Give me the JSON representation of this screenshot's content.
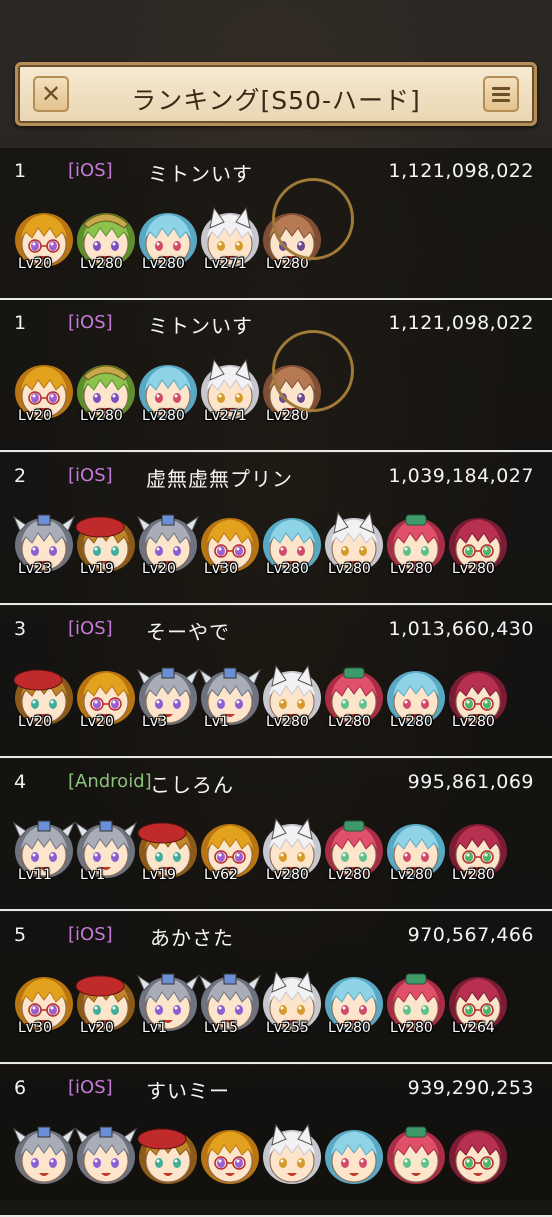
{
  "header": {
    "title": "ランキング[S50-ハード]",
    "close_icon": "close-x-icon",
    "menu_icon": "hamburger-menu-icon"
  },
  "colors": {
    "ios": "#c77ad9",
    "android": "#8cc27e",
    "gold": "#b58f57"
  },
  "entries": [
    {
      "rank": "1",
      "platform": "[iOS]",
      "name": "ミトンいす",
      "score": "1,121,098,022",
      "team": [
        {
          "level": "Lv20",
          "kind": "gold"
        },
        {
          "level": "Lv280",
          "kind": "green"
        },
        {
          "level": "Lv280",
          "kind": "blue"
        },
        {
          "level": "Lv271",
          "kind": "white"
        },
        {
          "level": "Lv280",
          "kind": "brown"
        }
      ]
    },
    {
      "rank": "1",
      "platform": "[iOS]",
      "name": "ミトンいす",
      "score": "1,121,098,022",
      "team": [
        {
          "level": "Lv20",
          "kind": "gold"
        },
        {
          "level": "Lv280",
          "kind": "green"
        },
        {
          "level": "Lv280",
          "kind": "blue"
        },
        {
          "level": "Lv271",
          "kind": "white"
        },
        {
          "level": "Lv280",
          "kind": "brown"
        }
      ]
    },
    {
      "rank": "2",
      "platform": "[iOS]",
      "name": "虚無虚無プリン",
      "score": "1,039,184,027",
      "team": [
        {
          "level": "Lv23",
          "kind": "silver"
        },
        {
          "level": "Lv19",
          "kind": "patch"
        },
        {
          "level": "Lv20",
          "kind": "silver"
        },
        {
          "level": "Lv30",
          "kind": "gold"
        },
        {
          "level": "Lv280",
          "kind": "blue"
        },
        {
          "level": "Lv280",
          "kind": "white"
        },
        {
          "level": "Lv280",
          "kind": "pink"
        },
        {
          "level": "Lv280",
          "kind": "crimson"
        }
      ]
    },
    {
      "rank": "3",
      "platform": "[iOS]",
      "name": "そーやで",
      "score": "1,013,660,430",
      "team": [
        {
          "level": "Lv20",
          "kind": "patch"
        },
        {
          "level": "Lv20",
          "kind": "gold"
        },
        {
          "level": "Lv3",
          "kind": "silver"
        },
        {
          "level": "Lv1",
          "kind": "silver"
        },
        {
          "level": "Lv280",
          "kind": "white"
        },
        {
          "level": "Lv280",
          "kind": "pink"
        },
        {
          "level": "Lv280",
          "kind": "blue"
        },
        {
          "level": "Lv280",
          "kind": "crimson"
        }
      ]
    },
    {
      "rank": "4",
      "platform": "[Android]",
      "name": "こしろん",
      "score": "995,861,069",
      "team": [
        {
          "level": "Lv11",
          "kind": "silver"
        },
        {
          "level": "Lv1",
          "kind": "silver"
        },
        {
          "level": "Lv19",
          "kind": "patch"
        },
        {
          "level": "Lv62",
          "kind": "gold"
        },
        {
          "level": "Lv280",
          "kind": "white"
        },
        {
          "level": "Lv280",
          "kind": "pink"
        },
        {
          "level": "Lv280",
          "kind": "blue"
        },
        {
          "level": "Lv280",
          "kind": "crimson"
        }
      ]
    },
    {
      "rank": "5",
      "platform": "[iOS]",
      "name": "あかさた",
      "score": "970,567,466",
      "team": [
        {
          "level": "Lv30",
          "kind": "gold"
        },
        {
          "level": "Lv20",
          "kind": "patch"
        },
        {
          "level": "Lv1",
          "kind": "silver"
        },
        {
          "level": "Lv15",
          "kind": "silver"
        },
        {
          "level": "Lv255",
          "kind": "white"
        },
        {
          "level": "Lv280",
          "kind": "blue"
        },
        {
          "level": "Lv280",
          "kind": "pink"
        },
        {
          "level": "Lv264",
          "kind": "crimson"
        }
      ]
    },
    {
      "rank": "6",
      "platform": "[iOS]",
      "name": "すいミー",
      "score": "939,290,253",
      "team": [
        {
          "level": "",
          "kind": "silver"
        },
        {
          "level": "",
          "kind": "silver"
        },
        {
          "level": "",
          "kind": "patch"
        },
        {
          "level": "",
          "kind": "gold"
        },
        {
          "level": "",
          "kind": "white"
        },
        {
          "level": "",
          "kind": "blue"
        },
        {
          "level": "",
          "kind": "pink"
        },
        {
          "level": "",
          "kind": "crimson"
        }
      ]
    }
  ]
}
